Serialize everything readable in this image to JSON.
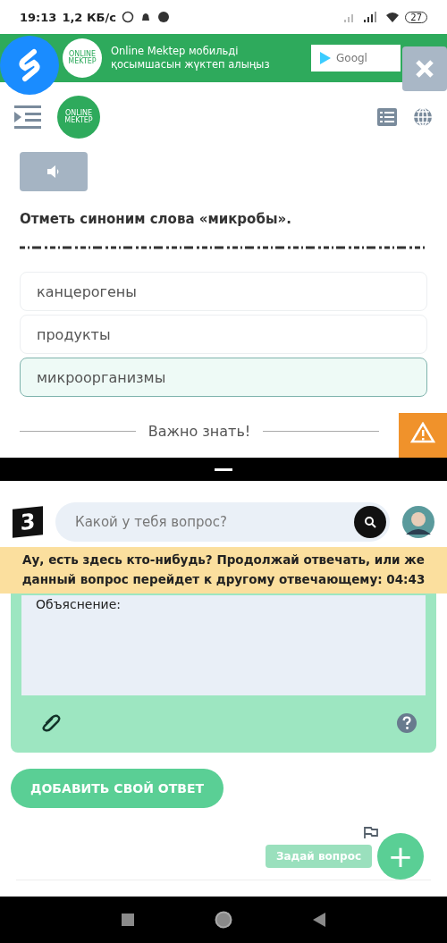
{
  "status_bar": {
    "time": "19:13",
    "speed": "1,2 КБ/с",
    "battery": "27"
  },
  "app_banner": {
    "text": "Online Mektep мобильді қосымшасын жүктеп алыңыз",
    "store_button": "Googl",
    "logo_text": "ONLINE MEKTEP"
  },
  "header": {
    "logo_text": "ONLINE MEKTEP"
  },
  "question": {
    "text": "Отметь синоним слова «микробы»."
  },
  "options": [
    {
      "label": "канцерогены",
      "selected": false
    },
    {
      "label": "продукты",
      "selected": false
    },
    {
      "label": "микроорганизмы",
      "selected": true
    }
  ],
  "divider_label": "Важно знать!",
  "brainly": {
    "logo": "3",
    "search_placeholder": "Какой у тебя вопрос?",
    "notice": "Ау, есть здесь кто-нибудь? Продолжай отвечать, или же данный вопрос перейдет к другому отвечающему: **04:43**",
    "answer_value": "Объяснение:",
    "add_answer_button": "ДОБАВИТЬ СВОЙ ОТВЕТ",
    "ask_button": "Задай вопрос",
    "fab": "+"
  }
}
